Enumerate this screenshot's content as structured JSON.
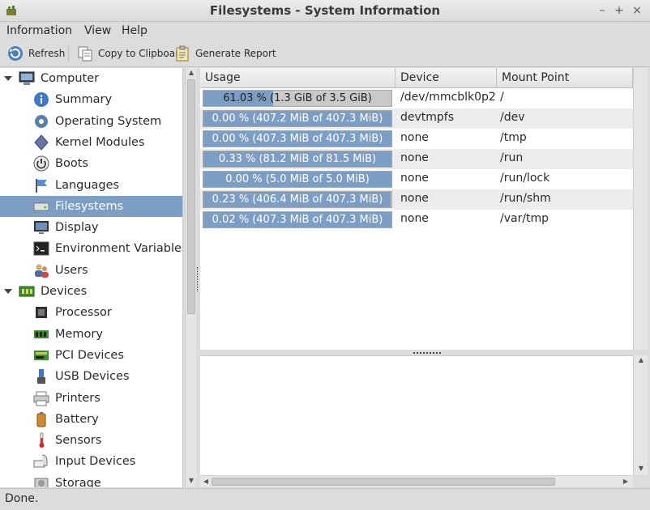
{
  "window": {
    "title": "Filesystems - System Information",
    "controls": {
      "minimize": "–",
      "maximize": "+",
      "close": "×"
    }
  },
  "menubar": {
    "items": [
      "Information",
      "View",
      "Help"
    ]
  },
  "toolbar": {
    "refresh_label": "Refresh",
    "copy_label": "Copy to Clipboard",
    "report_label": "Generate Report"
  },
  "sidebar": {
    "selected": "Filesystems",
    "groups": [
      {
        "label": "Computer",
        "icon": "computer-icon",
        "items": [
          {
            "label": "Summary",
            "icon": "info-icon"
          },
          {
            "label": "Operating System",
            "icon": "gear-icon"
          },
          {
            "label": "Kernel Modules",
            "icon": "module-icon"
          },
          {
            "label": "Boots",
            "icon": "power-icon"
          },
          {
            "label": "Languages",
            "icon": "flag-icon"
          },
          {
            "label": "Filesystems",
            "icon": "drive-icon"
          },
          {
            "label": "Display",
            "icon": "monitor-icon"
          },
          {
            "label": "Environment Variables",
            "icon": "terminal-icon"
          },
          {
            "label": "Users",
            "icon": "users-icon"
          }
        ]
      },
      {
        "label": "Devices",
        "icon": "devices-icon",
        "items": [
          {
            "label": "Processor",
            "icon": "cpu-icon"
          },
          {
            "label": "Memory",
            "icon": "memory-icon"
          },
          {
            "label": "PCI Devices",
            "icon": "pci-icon"
          },
          {
            "label": "USB Devices",
            "icon": "usb-icon"
          },
          {
            "label": "Printers",
            "icon": "printer-icon"
          },
          {
            "label": "Battery",
            "icon": "battery-icon"
          },
          {
            "label": "Sensors",
            "icon": "thermometer-icon"
          },
          {
            "label": "Input Devices",
            "icon": "input-icon"
          },
          {
            "label": "Storage",
            "icon": "storage-icon"
          }
        ]
      }
    ]
  },
  "table": {
    "columns": [
      "Usage",
      "Device",
      "Mount Point"
    ],
    "rows": [
      {
        "usage_pct": 0.3703,
        "usage_text": "61.03 % (1.3 GiB of 3.5 GiB)",
        "device": "/dev/mmcblk0p2",
        "mount": "/"
      },
      {
        "usage_pct": 0.9998,
        "usage_text": "0.00 % (407.2 MiB of 407.3 MiB)",
        "device": "devtmpfs",
        "mount": "/dev"
      },
      {
        "usage_pct": 1.0,
        "usage_text": "0.00 % (407.3 MiB of 407.3 MiB)",
        "device": "none",
        "mount": "/tmp"
      },
      {
        "usage_pct": 1.0,
        "usage_text": "0.33 % (81.2 MiB of 81.5 MiB)",
        "device": "none",
        "mount": "/run"
      },
      {
        "usage_pct": 1.0,
        "usage_text": "0.00 % (5.0 MiB of 5.0 MiB)",
        "device": "none",
        "mount": "/run/lock"
      },
      {
        "usage_pct": 0.9977,
        "usage_text": "0.23 % (406.4 MiB of 407.3 MiB)",
        "device": "none",
        "mount": "/run/shm"
      },
      {
        "usage_pct": 0.9998,
        "usage_text": "0.02 % (407.3 MiB of 407.3 MiB)",
        "device": "none",
        "mount": "/var/tmp"
      }
    ]
  },
  "status": {
    "text": "Done."
  },
  "colors": {
    "accent": "#7d9ec4",
    "bar_bg": "#c9c9c9"
  }
}
